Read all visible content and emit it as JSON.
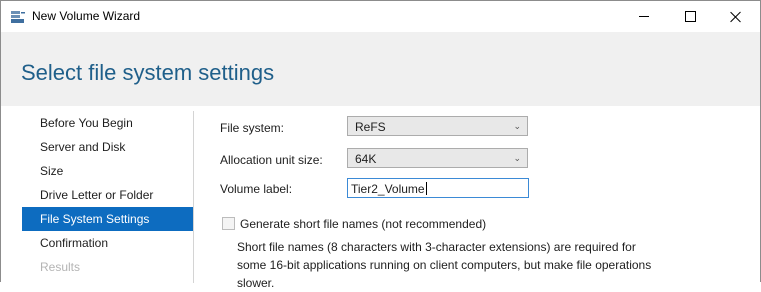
{
  "window": {
    "title": "New Volume Wizard",
    "icon": "disk-volume-icon"
  },
  "page": {
    "title": "Select file system settings"
  },
  "nav": {
    "items": [
      {
        "label": "Before You Begin",
        "state": "normal"
      },
      {
        "label": "Server and Disk",
        "state": "normal"
      },
      {
        "label": "Size",
        "state": "normal"
      },
      {
        "label": "Drive Letter or Folder",
        "state": "normal"
      },
      {
        "label": "File System Settings",
        "state": "active"
      },
      {
        "label": "Confirmation",
        "state": "normal"
      },
      {
        "label": "Results",
        "state": "disabled"
      }
    ]
  },
  "form": {
    "file_system": {
      "label": "File system:",
      "value": "ReFS"
    },
    "allocation_unit": {
      "label": "Allocation unit size:",
      "value": "64K"
    },
    "volume_label": {
      "label": "Volume label:",
      "value": "Tier2_Volume"
    },
    "short_names": {
      "label": "Generate short file names (not recommended)",
      "checked": false,
      "description": "Short file names (8 characters with 3-character extensions) are required for some 16-bit applications running on client computers, but make file operations slower."
    }
  },
  "colors": {
    "accent": "#0d6cc0",
    "title": "#1f5f8a",
    "header_band": "#f0f0f0"
  }
}
